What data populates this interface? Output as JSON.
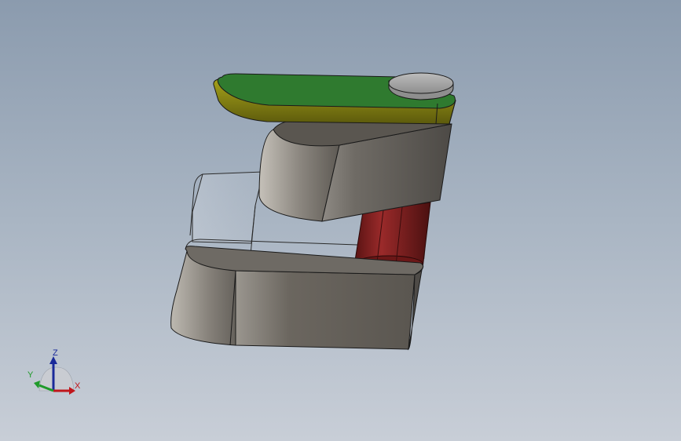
{
  "triad": {
    "x_label": "X",
    "y_label": "Y",
    "z_label": "Z",
    "x_color": "#c0161b",
    "y_color": "#1f9a2a",
    "z_color": "#1a2a9a"
  },
  "model": {
    "top_plate_color": "#2f7a2f",
    "top_plate_edge_color": "#8c8a12",
    "cylinder_color": "#7a1c1c",
    "body_color": "#5e5a55",
    "cap_color": "#a8a8a8"
  }
}
